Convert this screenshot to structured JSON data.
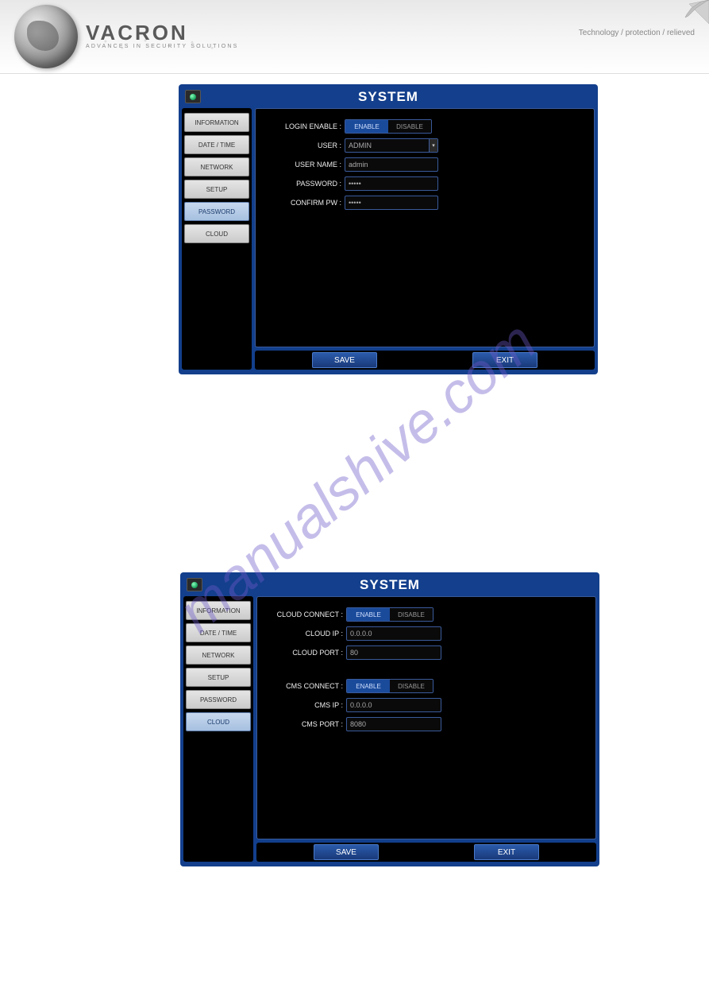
{
  "brand": {
    "name": "VACRON",
    "tagline": "ADVANCES IN SECURITY SOLUTIONS",
    "slogan": "Technology / protection / relieved"
  },
  "watermark": "manualshive.com",
  "panels": [
    {
      "title": "SYSTEM",
      "active_tab": "PASSWORD",
      "tabs": [
        "INFORMATION",
        "DATE / TIME",
        "NETWORK",
        "SETUP",
        "PASSWORD",
        "CLOUD"
      ],
      "fields": {
        "login_enable": {
          "label": "LOGIN ENABLE :",
          "enable": "ENABLE",
          "disable": "DISABLE",
          "selected": "ENABLE"
        },
        "user": {
          "label": "USER :",
          "value": "ADMIN",
          "dropdown": true
        },
        "user_name": {
          "label": "USER NAME :",
          "value": "admin"
        },
        "password": {
          "label": "PASSWORD :",
          "value": "•••••"
        },
        "confirm_pw": {
          "label": "CONFIRM PW :",
          "value": "•••••"
        }
      },
      "buttons": {
        "save": "SAVE",
        "exit": "EXIT"
      }
    },
    {
      "title": "SYSTEM",
      "active_tab": "CLOUD",
      "tabs": [
        "INFORMATION",
        "DATE / TIME",
        "NETWORK",
        "SETUP",
        "PASSWORD",
        "CLOUD"
      ],
      "fields": {
        "cloud_connect": {
          "label": "CLOUD CONNECT :",
          "enable": "ENABLE",
          "disable": "DISABLE",
          "selected": "ENABLE"
        },
        "cloud_ip": {
          "label": "CLOUD IP :",
          "value": "0.0.0.0"
        },
        "cloud_port": {
          "label": "CLOUD PORT :",
          "value": "80"
        },
        "cms_connect": {
          "label": "CMS CONNECT :",
          "enable": "ENABLE",
          "disable": "DISABLE",
          "selected": "ENABLE"
        },
        "cms_ip": {
          "label": "CMS IP :",
          "value": "0.0.0.0"
        },
        "cms_port": {
          "label": "CMS PORT :",
          "value": "8080"
        }
      },
      "buttons": {
        "save": "SAVE",
        "exit": "EXIT"
      }
    }
  ]
}
